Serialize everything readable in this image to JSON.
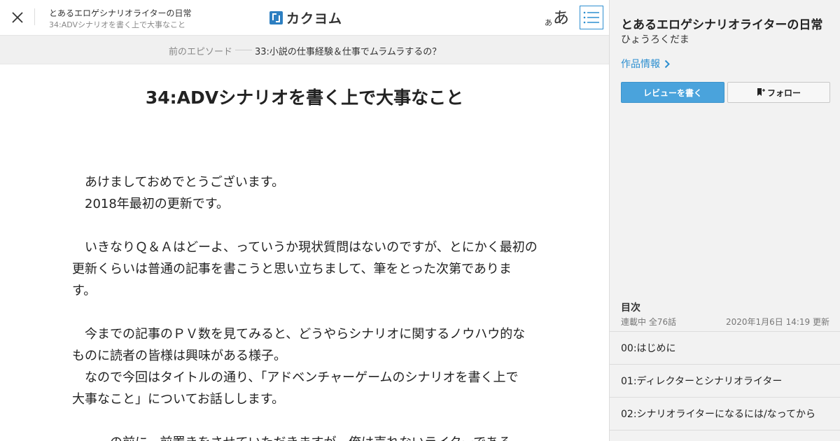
{
  "header": {
    "work_title": "とあるエロゲシナリオライターの日常",
    "episode_subtitle": "34:ADVシナリオを書く上で大事なこと",
    "logo_text": "カクヨム",
    "font_size_small": "あ",
    "font_size_large": "あ"
  },
  "prev_episode": {
    "label": "前のエピソード",
    "title": "33:小説の仕事経験＆仕事でムラムラするの？"
  },
  "episode": {
    "title": "34:ADVシナリオを書く上で大事なこと",
    "paragraphs": [
      "　あけましておめでとうございます。",
      "　2018年最初の更新です。",
      "",
      "　いきなりＱ＆Ａはどーよ、っていうか現状質問はないのですが、とにかく最初の",
      "更新くらいは普通の記事を書こうと思い立ちまして、筆をとった次第でありま",
      "す。",
      "",
      "　今までの記事のＰＶ数を見てみると、どうやらシナリオに関するノウハウ的な",
      "ものに読者の皆様は興味がある様子。",
      "　なので今回はタイトルの通り、「アドベンチャーゲームのシナリオを書く上で",
      "大事なこと」についてお話しします。",
      "",
      "　……の前に、前置きをさせていただきますが、俺は売れないライターである"
    ]
  },
  "sidebar": {
    "title": "とあるエロゲシナリオライターの日常",
    "author": "ひょうろくだま",
    "info_link": "作品情報",
    "review_button": "レビューを書く",
    "follow_button": "フォロー",
    "toc_heading": "目次",
    "toc_status": "連載中 全76話",
    "toc_updated": "2020年1月6日 14:19 更新",
    "toc_items": [
      "00:はじめに",
      "01:ディレクターとシナリオライター",
      "02:シナリオライターになるには/なってから"
    ]
  },
  "colors": {
    "accent": "#2d8fd0",
    "review_button_bg": "#4aa3dc",
    "logo_blue": "#2d7fc1",
    "sidebar_bg": "#f2f2f2",
    "prev_bar_bg": "#f0f0f0"
  },
  "icons": {
    "close": "close-icon",
    "toc": "list-icon",
    "info_arrow": "chevron-right-icon",
    "follow": "bookmark-plus-icon"
  }
}
